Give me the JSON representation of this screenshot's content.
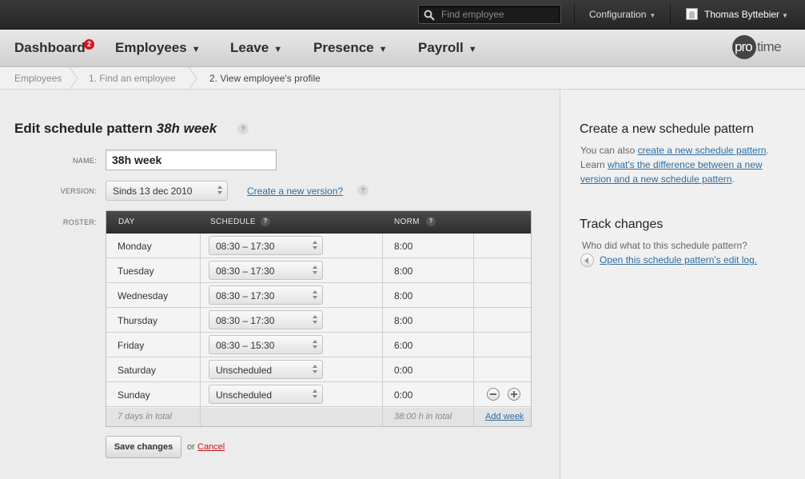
{
  "topbar": {
    "search_placeholder": "Find employee",
    "configuration_label": "Configuration",
    "user_name": "Thomas Byttebier"
  },
  "nav": {
    "dashboard": "Dashboard",
    "dashboard_badge": "2",
    "employees": "Employees",
    "leave": "Leave",
    "presence": "Presence",
    "payroll": "Payroll",
    "logo_pro": "pro",
    "logo_time": "time"
  },
  "breadcrumb": {
    "items": [
      "Employees",
      "1. Find an employee",
      "2. View employee's profile"
    ]
  },
  "form": {
    "title_prefix": "Edit schedule pattern",
    "title_name": "38h week",
    "name_label": "NAME:",
    "name_value": "38h week",
    "version_label": "VERSION:",
    "version_value": "Sinds 13 dec 2010",
    "create_version_link": "Create a new version?",
    "roster_label": "ROSTER:"
  },
  "roster": {
    "headers": {
      "day": "DAY",
      "schedule": "SCHEDULE",
      "norm": "NORM"
    },
    "rows": [
      {
        "day": "Monday",
        "schedule": "08:30 – 17:30",
        "norm": "8:00"
      },
      {
        "day": "Tuesday",
        "schedule": "08:30 – 17:30",
        "norm": "8:00"
      },
      {
        "day": "Wednesday",
        "schedule": "08:30 – 17:30",
        "norm": "8:00"
      },
      {
        "day": "Thursday",
        "schedule": "08:30 – 17:30",
        "norm": "8:00"
      },
      {
        "day": "Friday",
        "schedule": "08:30 – 15:30",
        "norm": "6:00"
      },
      {
        "day": "Saturday",
        "schedule": "Unscheduled",
        "norm": "0:00"
      },
      {
        "day": "Sunday",
        "schedule": "Unscheduled",
        "norm": "0:00"
      }
    ],
    "total_days": "7 days in total",
    "total_hours": "38:00 h in total",
    "add_week": "Add week"
  },
  "actions": {
    "save": "Save changes",
    "or": "or",
    "cancel": "Cancel"
  },
  "sidebar": {
    "create_heading": "Create a new schedule pattern",
    "create_text_1": "You can also ",
    "create_link_1": "create a new schedule pattern",
    "create_text_2": ".",
    "learn_text": "Learn ",
    "learn_link_1": "what's the difference between a new",
    "learn_link_2": "version and a new schedule pattern",
    "learn_end": ".",
    "track_heading": "Track changes",
    "track_text": "Who did what to this schedule pattern?",
    "track_link": "Open this schedule pattern's edit log."
  },
  "help_glyph": "?"
}
